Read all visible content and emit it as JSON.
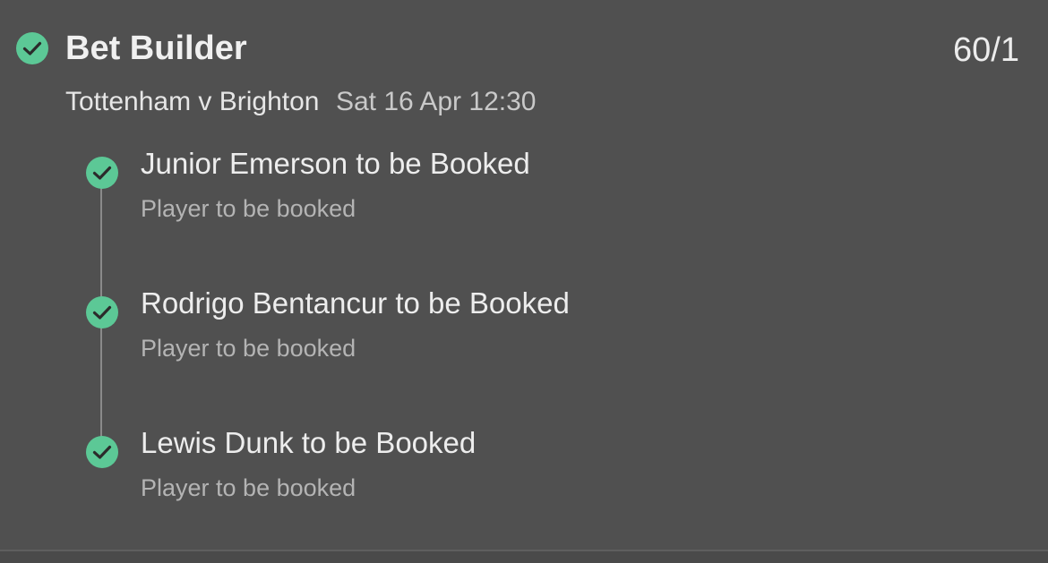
{
  "bet": {
    "title": "Bet Builder",
    "odds": "60/1",
    "status_icon": "check-circle-icon",
    "match": "Tottenham v Brighton",
    "datetime": "Sat 16 Apr 12:30"
  },
  "legs": [
    {
      "title": "Junior Emerson to be Booked",
      "subtitle": "Player to be booked",
      "status_icon": "check-circle-icon"
    },
    {
      "title": "Rodrigo Bentancur to be Booked",
      "subtitle": "Player to be booked",
      "status_icon": "check-circle-icon"
    },
    {
      "title": "Lewis Dunk to be Booked",
      "subtitle": "Player to be booked",
      "status_icon": "check-circle-icon"
    }
  ],
  "colors": {
    "background": "#505050",
    "check_fill": "#5cc896",
    "check_mark": "#2b2b2b"
  }
}
